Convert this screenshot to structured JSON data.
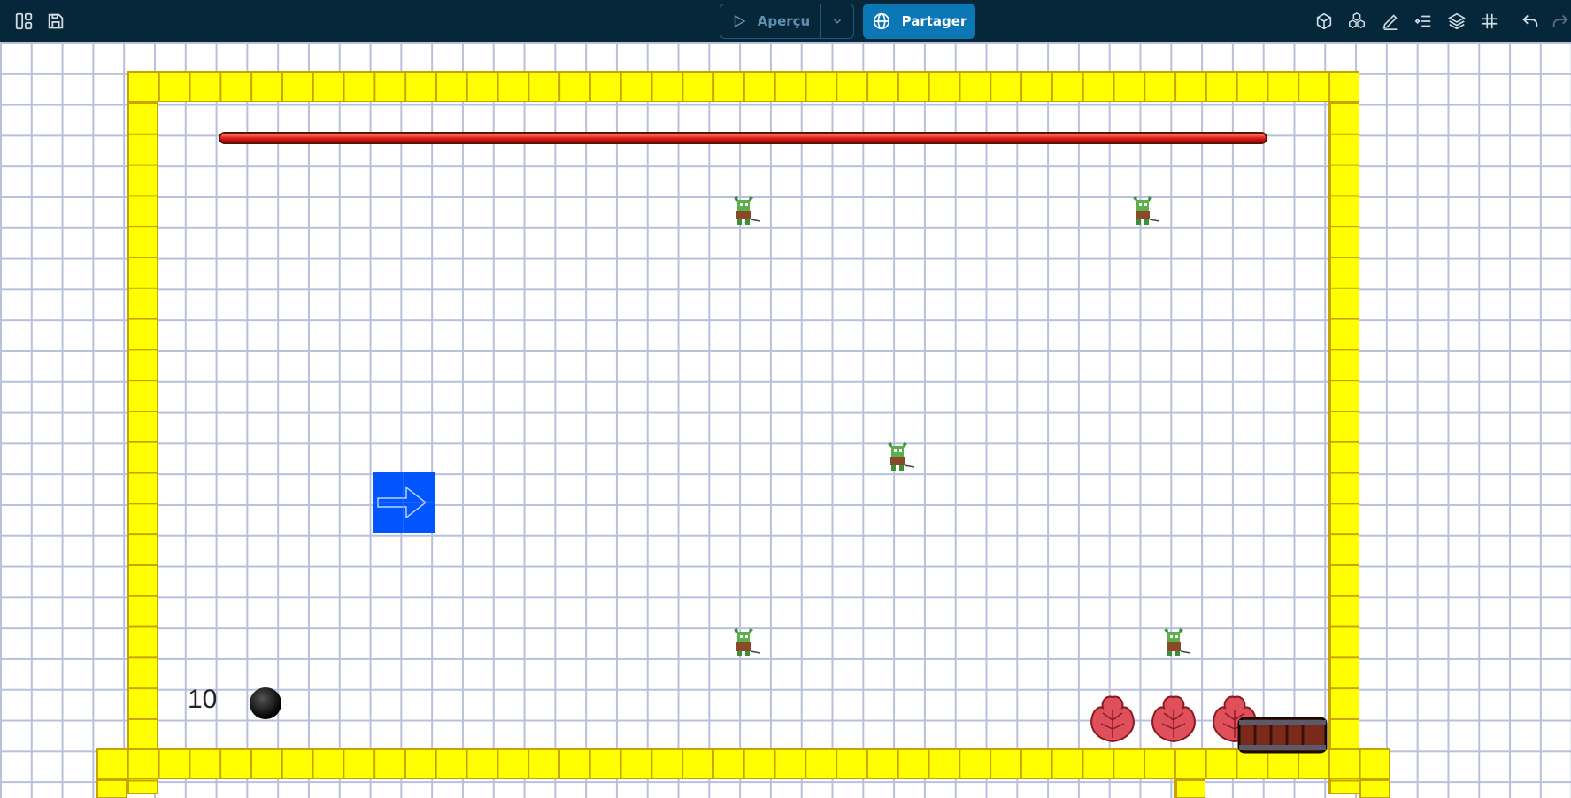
{
  "toolbar": {
    "left_icons": [
      "layout-panels-icon",
      "save-icon"
    ],
    "preview_label": "Aperçu",
    "share_label": "Partager",
    "right_icons": [
      "cube-icon",
      "cubes-icon",
      "pencil-icon",
      "list-icon",
      "layers-icon",
      "grid-icon",
      "undo-icon",
      "redo-icon"
    ],
    "colors": {
      "bar": "#06263a",
      "share": "#0b77b4"
    }
  },
  "scene": {
    "counter_value": "10",
    "objects": [
      "yellow-wall",
      "red-laser",
      "goblin",
      "blue-arrow-player",
      "black-ball",
      "red-flower",
      "barrel"
    ],
    "colors": {
      "wall": "#ffff00",
      "player": "#0055ff",
      "laser": "#e02020",
      "grid": "#b8c0dc"
    }
  }
}
